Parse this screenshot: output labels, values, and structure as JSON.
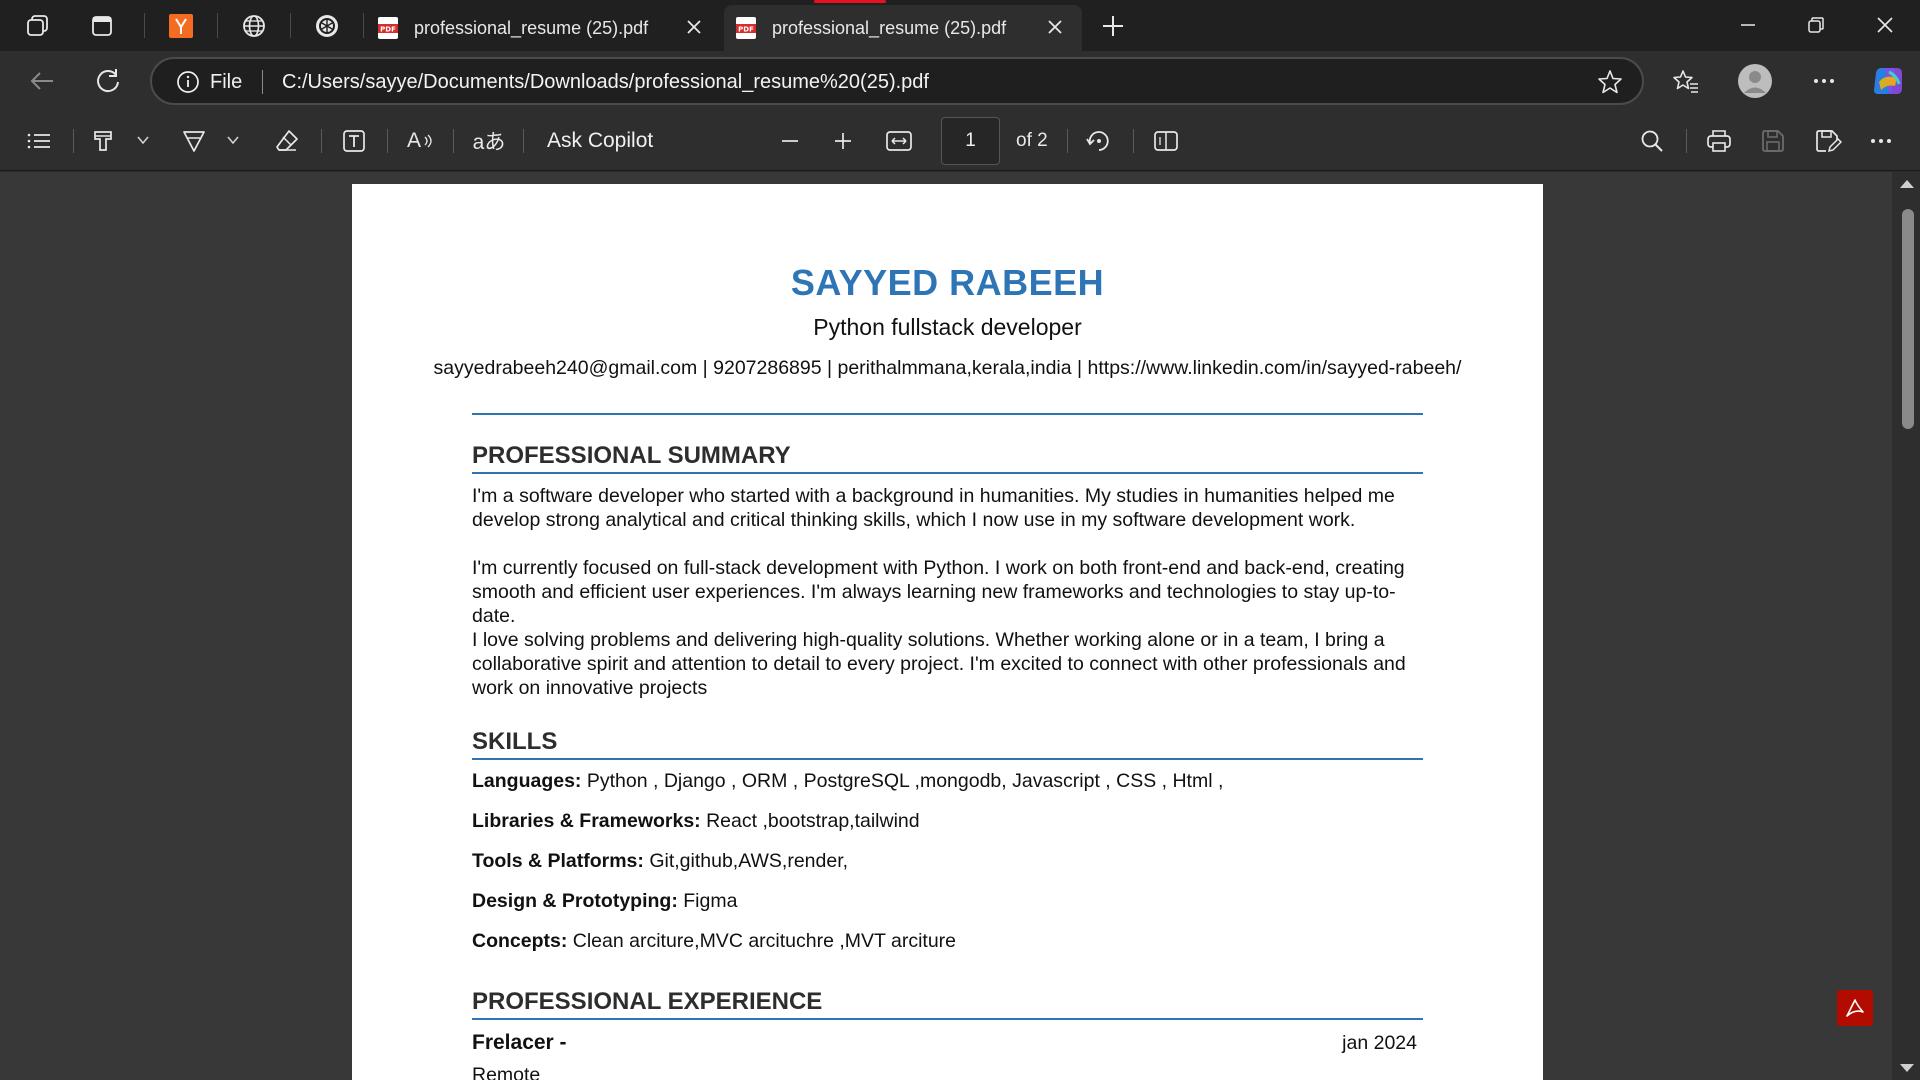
{
  "tabs": [
    {
      "title": "professional_resume (25).pdf",
      "active": false
    },
    {
      "title": "professional_resume (25).pdf",
      "active": true
    }
  ],
  "address": {
    "scheme_label": "File",
    "url": "C:/Users/sayye/Documents/Downloads/professional_resume%20(25).pdf"
  },
  "pdf_toolbar": {
    "ask_copilot": "Ask Copilot",
    "page_current": "1",
    "page_total": "of 2",
    "translate_glyph": "aあ",
    "read_aloud_glyph": "A"
  },
  "colors": {
    "accent_tab": "#e81123",
    "name_blue": "#2e75b6",
    "acrobat_red": "#b30b00",
    "yandex_orange": "#f36c21"
  },
  "resume": {
    "name": "SAYYED RABEEH",
    "title": "Python fullstack developer",
    "contact": "sayyedrabeeh240@gmail.com | 9207286895 | perithalmmana,kerala,india | https://www.linkedin.com/in/sayyed-rabeeh/",
    "sections": {
      "summary_heading": "PROFESSIONAL SUMMARY",
      "summary_p1": "I'm a software developer who started with a background in humanities. My studies in humanities helped me develop strong analytical and critical thinking skills, which I now use in my software development work.",
      "summary_p2": "I'm currently focused on full-stack development with Python. I work on both front-end and back-end, creating smooth and efficient user experiences. I'm always learning new frameworks and technologies to stay up-to-date.",
      "summary_p3": "I love solving problems and delivering high-quality solutions. Whether working alone or in a team, I bring a collaborative spirit and attention to detail to every project. I'm excited to connect with other professionals and work on innovative projects",
      "skills_heading": "SKILLS",
      "skills": [
        {
          "label": "Languages:",
          "value": " Python , Django , ORM , PostgreSQL ,mongodb, Javascript , CSS , Html ,"
        },
        {
          "label": "Libraries & Frameworks:",
          "value": " React ,bootstrap,tailwind"
        },
        {
          "label": "Tools & Platforms:",
          "value": " Git,github,AWS,render,"
        },
        {
          "label": "Design & Prototyping:",
          "value": " Figma"
        },
        {
          "label": "Concepts:",
          "value": " Clean arciture,MVC arcituchre ,MVT arciture"
        }
      ],
      "experience_heading": "PROFESSIONAL EXPERIENCE",
      "job_title": "Frelacer -",
      "job_date": "jan 2024",
      "job_location": "Remote"
    }
  }
}
